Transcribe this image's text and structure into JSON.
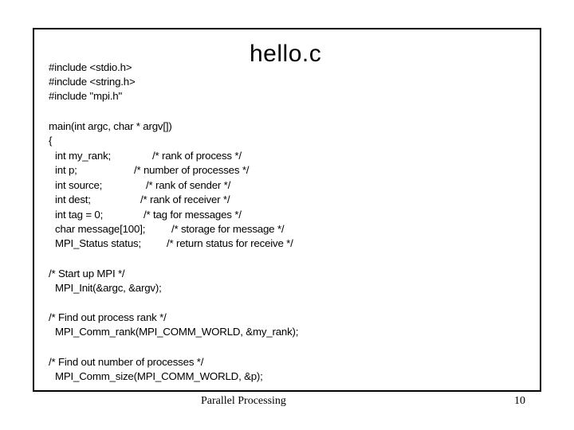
{
  "slide": {
    "title": "hello.c",
    "includes": [
      "#include <stdio.h>",
      "#include <string.h>",
      "#include \"mpi.h\""
    ],
    "main_signature": "main(int argc, char * argv[])",
    "open_brace": "{",
    "declarations": [
      {
        "code": "int my_rank;",
        "comment": "/* rank of process */"
      },
      {
        "code": "int p;",
        "comment": "/* number of processes */"
      },
      {
        "code": "int source;",
        "comment": "/* rank of sender */"
      },
      {
        "code": "int dest;",
        "comment": "/* rank of receiver */"
      },
      {
        "code": "int tag = 0;",
        "comment": "/* tag for messages */"
      },
      {
        "code": "char message[100];",
        "comment": "/* storage for message */"
      },
      {
        "code": "MPI_Status status;",
        "comment": "/* return status for receive */"
      }
    ],
    "blocks": [
      {
        "comment": "/* Start up MPI */",
        "code": "MPI_Init(&argc, &argv);"
      },
      {
        "comment": "/* Find out process rank */",
        "code": "MPI_Comm_rank(MPI_COMM_WORLD, &my_rank);"
      },
      {
        "comment": "/* Find out number of processes */",
        "code": "MPI_Comm_size(MPI_COMM_WORLD, &p);"
      }
    ]
  },
  "footer": {
    "course": "Parallel Processing",
    "page_number": "10"
  }
}
